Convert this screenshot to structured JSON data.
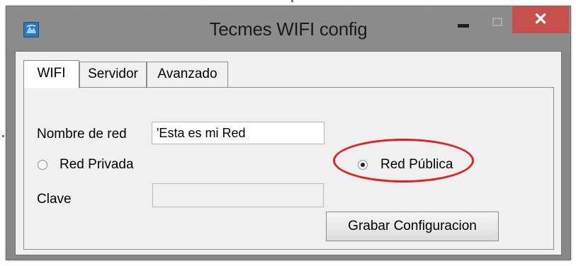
{
  "window": {
    "title": "Tecmes WIFI config",
    "icon": "app-icon",
    "controls": {
      "close_label": "✕"
    }
  },
  "tabs": [
    {
      "label": "WIFI",
      "active": true
    },
    {
      "label": "Servidor",
      "active": false
    },
    {
      "label": "Avanzado",
      "active": false
    }
  ],
  "form": {
    "network_name_label": "Nombre de red",
    "network_name_value": "'Esta es mi Red",
    "private_radio_label": "Red Privada",
    "private_selected": false,
    "public_radio_label": "Red Pública",
    "public_selected": true,
    "password_label": "Clave",
    "password_value": "",
    "save_button_label": "Grabar Configuracion"
  },
  "colors": {
    "close_button": "#c7504c",
    "highlight_ring": "#e31f1f"
  }
}
